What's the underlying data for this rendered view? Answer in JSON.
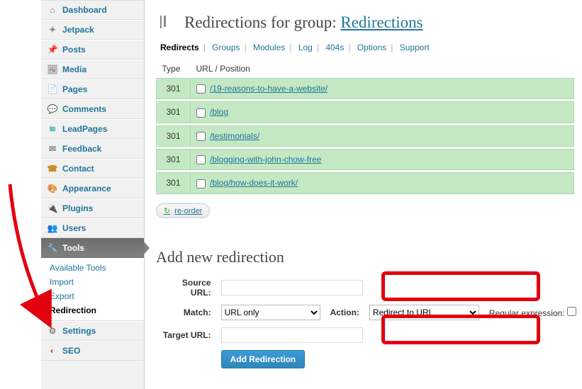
{
  "sidebar": {
    "items": [
      {
        "label": "Dashboard",
        "icon": "dashboard"
      },
      {
        "label": "Jetpack",
        "icon": "jetpack"
      },
      {
        "label": "Posts",
        "icon": "pin"
      },
      {
        "label": "Media",
        "icon": "media"
      },
      {
        "label": "Pages",
        "icon": "page"
      },
      {
        "label": "Comments",
        "icon": "comment"
      },
      {
        "label": "LeadPages",
        "icon": "lead"
      },
      {
        "label": "Feedback",
        "icon": "feedback"
      },
      {
        "label": "Contact",
        "icon": "contact"
      },
      {
        "label": "Appearance",
        "icon": "appearance"
      },
      {
        "label": "Plugins",
        "icon": "plugin"
      },
      {
        "label": "Users",
        "icon": "users"
      },
      {
        "label": "Tools",
        "icon": "tools"
      },
      {
        "label": "Settings",
        "icon": "settings"
      },
      {
        "label": "SEO",
        "icon": "seo"
      }
    ],
    "tools_submenu": [
      {
        "label": "Available Tools"
      },
      {
        "label": "Import"
      },
      {
        "label": "Export"
      },
      {
        "label": "Redirection",
        "active": true
      }
    ]
  },
  "page": {
    "title_prefix": "Redirections for group: ",
    "title_link": "Redirections"
  },
  "subnav": {
    "items": [
      "Redirects",
      "Groups",
      "Modules",
      "Log",
      "404s",
      "Options",
      "Support"
    ],
    "active": "Redirects"
  },
  "table": {
    "headers": {
      "type": "Type",
      "url": "URL / Position"
    },
    "rows": [
      {
        "type": "301",
        "url": "/19-reasons-to-have-a-website/"
      },
      {
        "type": "301",
        "url": "/blog"
      },
      {
        "type": "301",
        "url": "/testimonials/"
      },
      {
        "type": "301",
        "url": "/blogging-with-john-chow-free"
      },
      {
        "type": "301",
        "url": "/blog/how-does-it-work/"
      }
    ],
    "reorder": "re-order"
  },
  "form": {
    "title": "Add new redirection",
    "source_label": "Source URL:",
    "match_label": "Match:",
    "match_value": "URL only",
    "action_label": "Action:",
    "action_value": "Redirect to URL",
    "regex_label": "Regular expression:",
    "target_label": "Target URL:",
    "submit": "Add Redirection"
  }
}
